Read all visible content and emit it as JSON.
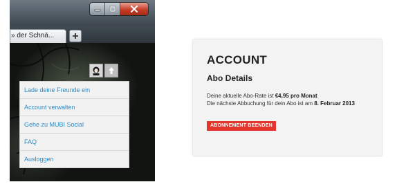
{
  "browser": {
    "tab_title": "» der Schnä...",
    "new_tab_label": "+"
  },
  "user_menu": {
    "items": [
      {
        "label": "Lade deine Freunde ein"
      },
      {
        "label": "Account verwalten"
      },
      {
        "label": "Gehe zu MUBI Social"
      },
      {
        "label": "FAQ"
      },
      {
        "label": "Ausloggen"
      }
    ]
  },
  "account": {
    "title": "ACCOUNT",
    "section_title": "Abo Details",
    "rate_prefix": "Deine aktuelle Abo-Rate ist ",
    "rate_value": "€4,95 pro Monat",
    "next_prefix": "Die nächste Abbuchung für dein Abo ist am ",
    "next_date": "8. Februar 2013",
    "cancel_label": "ABONNEMENT BEENDEN"
  },
  "colors": {
    "link_blue": "#2f8cc7",
    "cancel_red": "#e3352b",
    "close_red": "#c73d26"
  },
  "icons": [
    "minimize-icon",
    "maximize-icon",
    "close-icon",
    "user-avatar-icon",
    "upload-arrow-icon",
    "plus-icon"
  ]
}
